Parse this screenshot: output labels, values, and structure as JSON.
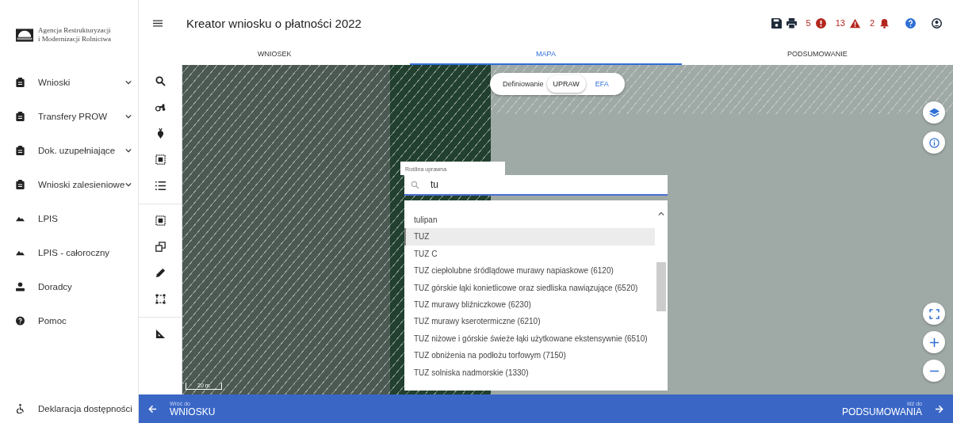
{
  "logo": {
    "line1": "Agencja Restrukturyzacji",
    "line2": "i Modernizacji Rolnictwa"
  },
  "header": {
    "title": "Kreator wniosku o płatności 2022",
    "errors": "5",
    "warnings": "13",
    "notifications": "2"
  },
  "tabs": [
    {
      "label": "WNIOSEK",
      "selected": false
    },
    {
      "label": "MAPA",
      "selected": true
    },
    {
      "label": "PODSUMOWANIE",
      "selected": false
    }
  ],
  "sidebar": {
    "items": [
      {
        "label": "Wnioski",
        "kind": "clipboard",
        "expandable": true
      },
      {
        "label": "Transfery PROW",
        "kind": "clipboard",
        "expandable": true
      },
      {
        "label": "Dok. uzupełniające",
        "kind": "clipboard",
        "expandable": true
      },
      {
        "label": "Wnioski zalesieniowe",
        "kind": "clipboard",
        "expandable": true
      },
      {
        "label": "LPIS",
        "kind": "terrain",
        "expandable": false
      },
      {
        "label": "LPIS - całoroczny",
        "kind": "terrain",
        "expandable": false
      },
      {
        "label": "Doradcy",
        "kind": "person",
        "expandable": false
      },
      {
        "label": "Pomoc",
        "kind": "help",
        "expandable": false
      }
    ],
    "footer": "Deklaracja dostępności"
  },
  "map": {
    "mode_label": "Definiowanie",
    "modes": [
      {
        "label": "UPRAW",
        "selected": true
      },
      {
        "label": "EFA",
        "selected": false
      }
    ],
    "scale": "20 m"
  },
  "crop_field": {
    "label": "Roślina uprawna",
    "value": "tu",
    "options": [
      {
        "label": "tulipan",
        "selected": false
      },
      {
        "label": "TUZ",
        "selected": true
      },
      {
        "label": "TUZ C",
        "selected": false
      },
      {
        "label": "TUZ ciepłolubne śródlądowe murawy napiaskowe (6120)",
        "selected": false
      },
      {
        "label": "TUZ górskie łąki konietlicowe oraz siedliska nawiązujące (6520)",
        "selected": false
      },
      {
        "label": "TUZ murawy bliźniczkowe (6230)",
        "selected": false
      },
      {
        "label": "TUZ murawy kserotermiczne (6210)",
        "selected": false
      },
      {
        "label": "TUZ niżowe i górskie świeże łąki użytkowane ekstensywnie (6510)",
        "selected": false
      },
      {
        "label": "TUZ obniżenia na podłożu torfowym (7150)",
        "selected": false
      },
      {
        "label": "TUZ solniska nadmorskie (1330)",
        "selected": false
      }
    ]
  },
  "footer_nav": {
    "back": {
      "small": "Wróć do",
      "label": "WNIOSKU"
    },
    "next": {
      "small": "Idź do",
      "label": "PODSUMOWANIA"
    }
  }
}
